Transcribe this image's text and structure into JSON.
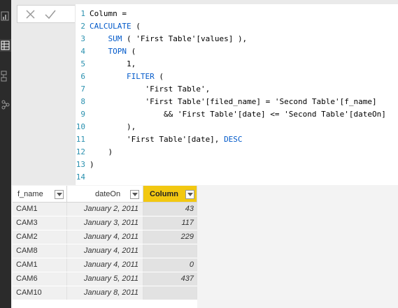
{
  "rail": {
    "icons": [
      "report-view-icon",
      "data-view-icon",
      "relationships-view-icon",
      "model-icon"
    ]
  },
  "editor": {
    "commit_buttons": [
      "cancel-icon",
      "check-icon"
    ],
    "lines": [
      {
        "n": "1",
        "text": "Column ="
      },
      {
        "n": "2",
        "text": "CALCULATE ("
      },
      {
        "n": "3",
        "text": "    SUM ( 'First Table'[values] ),"
      },
      {
        "n": "4",
        "text": "    TOPN ("
      },
      {
        "n": "5",
        "text": "        1,"
      },
      {
        "n": "6",
        "text": "        FILTER ("
      },
      {
        "n": "7",
        "text": "            'First Table',"
      },
      {
        "n": "8",
        "text": "            'First Table'[filed_name] = 'Second Table'[f_name]"
      },
      {
        "n": "9",
        "text": "                && 'First Table'[date] <= 'Second Table'[dateOn]"
      },
      {
        "n": "10",
        "text": "        ),"
      },
      {
        "n": "11",
        "text": "        'First Table'[date], DESC"
      },
      {
        "n": "12",
        "text": "    )"
      },
      {
        "n": "13",
        "text": ")"
      },
      {
        "n": "14",
        "text": ""
      }
    ]
  },
  "grid": {
    "columns": [
      {
        "label": "f_name",
        "active": false
      },
      {
        "label": "dateOn",
        "active": false
      },
      {
        "label": "Column",
        "active": true
      }
    ],
    "rows": [
      [
        "CAM1",
        "January 2, 2011",
        "43"
      ],
      [
        "CAM3",
        "January 3, 2011",
        "117"
      ],
      [
        "CAM2",
        "January 4, 2011",
        "229"
      ],
      [
        "CAM8",
        "January 4, 2011",
        ""
      ],
      [
        "CAM1",
        "January 4, 2011",
        "0"
      ],
      [
        "CAM6",
        "January 5, 2011",
        "437"
      ],
      [
        "CAM10",
        "January 8, 2011",
        ""
      ]
    ]
  },
  "colors": {
    "accent": "#f2c811",
    "keyword": "#035aca",
    "line_number": "#2b91af"
  }
}
